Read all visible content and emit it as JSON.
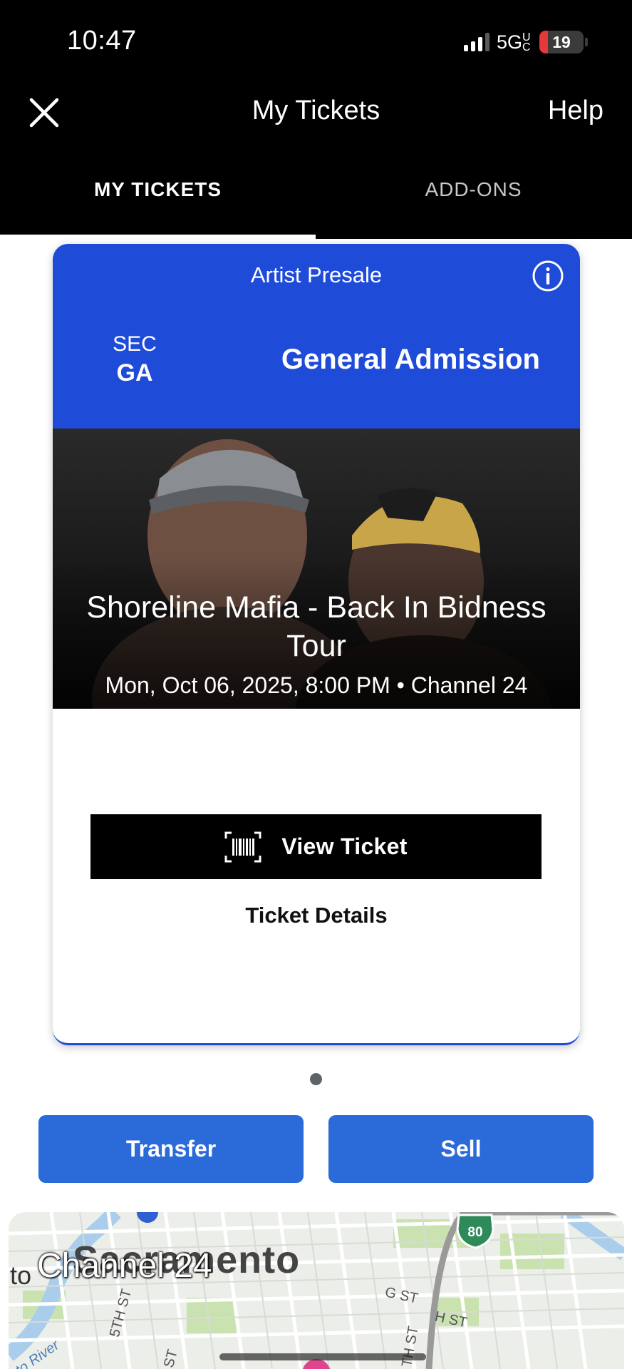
{
  "status_bar": {
    "time": "10:47",
    "network": "5G",
    "network_suffix": "UC",
    "battery_level": "19",
    "battery_percent": 19,
    "signal_bars_active": 3,
    "signal_bars_total": 4
  },
  "header": {
    "title": "My Tickets",
    "help_label": "Help",
    "close_icon": "close-icon"
  },
  "tabs": [
    {
      "label": "MY TICKETS",
      "active": true
    },
    {
      "label": "ADD-ONS",
      "active": false
    }
  ],
  "ticket": {
    "presale_label": "Artist Presale",
    "info_icon": "info-icon",
    "section_label": "SEC",
    "section_value": "GA",
    "admission": "General Admission",
    "event_name": "Shoreline Mafia - Back In Bidness Tour",
    "event_meta": "Mon, Oct 06, 2025, 8:00 PM • Channel 24",
    "view_ticket_label": "View Ticket",
    "barcode_icon": "barcode-icon",
    "details_label": "Ticket Details"
  },
  "pagination": {
    "current": 1,
    "total": 1
  },
  "actions": {
    "transfer_label": "Transfer",
    "sell_label": "Sell"
  },
  "map": {
    "city_label": "Sacramento",
    "venue_label": "Channel 24",
    "river_prefix": "to",
    "river_label": "to River",
    "highway_shield": "80",
    "streets": [
      "5TH ST",
      "G ST",
      "H ST",
      "ST",
      "TH ST"
    ]
  },
  "colors": {
    "header_bg": "#000000",
    "card_blue": "#1f4bd9",
    "action_blue": "#2a6ad9",
    "battery_low": "#e5383b"
  }
}
